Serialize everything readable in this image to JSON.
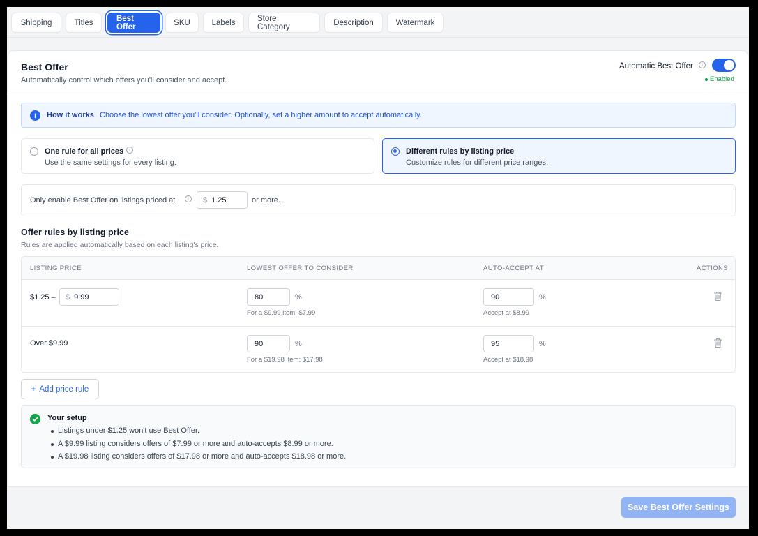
{
  "tabs": [
    "Shipping",
    "Titles",
    "Best Offer",
    "SKU",
    "Labels",
    "Store Category",
    "Description",
    "Watermark"
  ],
  "active_tab": "Best Offer",
  "header": {
    "title": "Best Offer",
    "subtitle": "Automatically control which offers you'll consider and accept.",
    "auto_label": "Automatic Best Offer",
    "auto_enabled": true,
    "status": "Enabled"
  },
  "how_it_works": {
    "title": "How it works",
    "text": "Choose the lowest offer you'll consider. Optionally, set a higher amount to accept automatically."
  },
  "options": [
    {
      "title": "One rule for all prices",
      "desc": "Use the same settings for every listing.",
      "selected": false
    },
    {
      "title": "Different rules by listing price",
      "desc": "Customize rules for different price ranges.",
      "selected": true
    }
  ],
  "min_price": {
    "label": "Only enable Best Offer on listings priced at",
    "currency": "$",
    "value": "1.25",
    "suffix": "or more."
  },
  "rules": {
    "title": "Offer rules by listing price",
    "subtitle": "Rules are applied automatically based on each listing's price.",
    "columns": [
      "LISTING PRICE",
      "LOWEST OFFER TO CONSIDER",
      "AUTO-ACCEPT AT",
      "ACTIONS"
    ],
    "rows": [
      {
        "price_prefix": "$1.25 –",
        "currency": "$",
        "max_value": "9.99",
        "lowest": "80",
        "lowest_hint": "For a $9.99 item: $7.99",
        "accept": "90",
        "accept_hint": "Accept at $8.99",
        "pct": "%"
      },
      {
        "price_label": "Over $9.99",
        "lowest": "90",
        "lowest_hint": "For a $19.98 item: $17.98",
        "accept": "95",
        "accept_hint": "Accept at $18.98",
        "pct": "%"
      }
    ],
    "add_label": "Add price rule"
  },
  "setup": {
    "title": "Your setup",
    "items": [
      "Listings under $1.25 won't use Best Offer.",
      "A $9.99 listing considers offers of $7.99 or more and auto-accepts $8.99 or more.",
      "A $19.98 listing considers offers of $17.98 or more and auto-accepts $18.98 or more."
    ]
  },
  "save_label": "Save Best Offer Settings",
  "colors": {
    "accent": "#2563eb",
    "success": "#16a34a",
    "save_disabled": "#93b4f4"
  }
}
